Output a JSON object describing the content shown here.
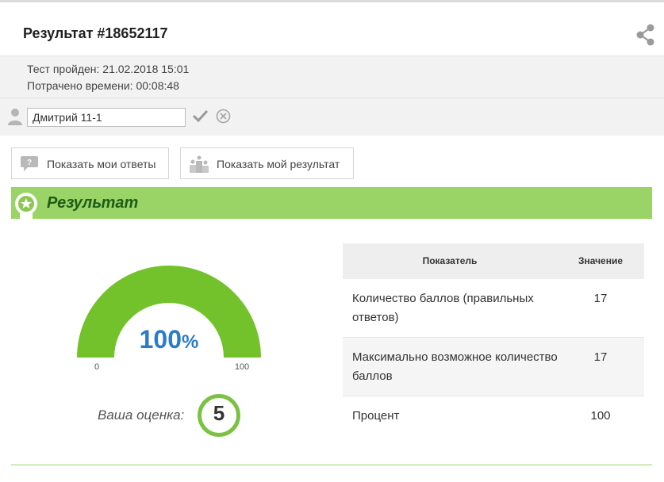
{
  "header": {
    "title": "Результат #18652117",
    "share_icon": "share-icon"
  },
  "info": {
    "passed": "Тест пройден: 21.02.2018 15:01",
    "time_spent": "Потрачено времени: 00:08:48"
  },
  "user": {
    "name_value": "Дмитрий 11-1"
  },
  "buttons": {
    "show_answers": "Показать мои ответы",
    "show_result": "Показать мой результат"
  },
  "banner": {
    "title": "Результат"
  },
  "gauge": {
    "value": "100",
    "unit": "%",
    "fraction": 1.0,
    "min": "0",
    "max": "100",
    "color": "#73c22b"
  },
  "grade": {
    "label": "Ваша оценка:",
    "value": "5"
  },
  "table": {
    "headers": [
      "Показатель",
      "Значение"
    ],
    "rows": [
      {
        "label": "Количество баллов (правильных ответов)",
        "value": "17"
      },
      {
        "label": "Максимально возможное количество баллов",
        "value": "17"
      },
      {
        "label": "Процент",
        "value": "100"
      }
    ]
  },
  "colors": {
    "accent_green": "#9bd466",
    "banner_text": "#1d5d17",
    "percent_blue": "#2b7cc6"
  }
}
